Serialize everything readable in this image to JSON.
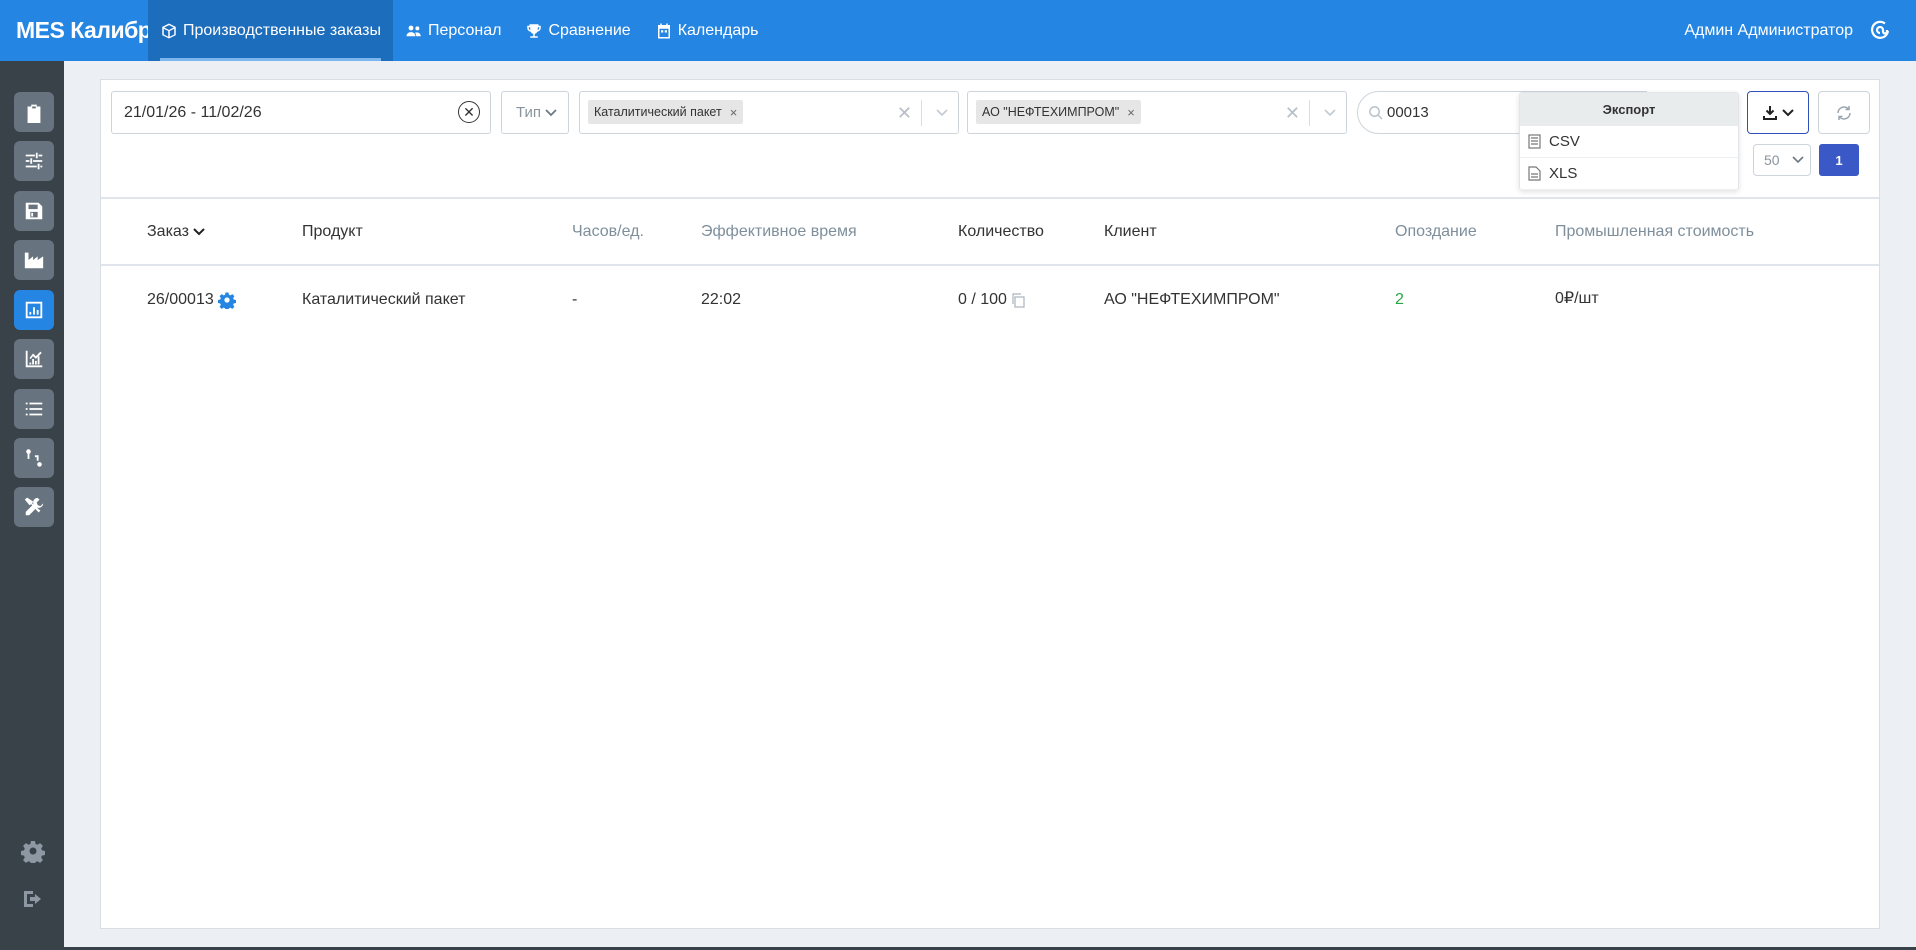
{
  "app": {
    "brand": "MES Калибр"
  },
  "nav": [
    {
      "label": "Производственные заказы",
      "icon": "box-icon",
      "active": true
    },
    {
      "label": "Персонал",
      "icon": "users-icon",
      "active": false
    },
    {
      "label": "Сравнение",
      "icon": "trophy-icon",
      "active": false
    },
    {
      "label": "Календарь",
      "icon": "calendar-icon",
      "active": false
    }
  ],
  "user": {
    "name": "Админ Администратор"
  },
  "filters": {
    "date_range": "21/01/26 - 11/02/26",
    "type_placeholder": "Тип",
    "product_chip": "Каталитический пакет",
    "client_chip": "АО \"НЕФТЕХИМПРОМ\"",
    "search_value": "00013"
  },
  "export_menu": {
    "title": "Экспорт",
    "items": [
      "CSV",
      "XLS"
    ]
  },
  "pagination": {
    "per_page": "50",
    "page": "1"
  },
  "table": {
    "headers": [
      "Заказ",
      "Продукт",
      "Часов/ед.",
      "Эффективное время",
      "Количество",
      "Клиент",
      "Опоздание",
      "Промышленная стоимость"
    ],
    "rows": [
      {
        "order": "26/00013",
        "product": "Каталитический пакет",
        "hours_per_unit": "-",
        "effective_time": "22:02",
        "quantity": "0 / 100",
        "client": "АО \"НЕФТЕХИМПРОМ\"",
        "delay": "2",
        "cost": "0₽/шт"
      }
    ]
  },
  "colors": {
    "primary": "#2585e2",
    "sidebar": "#3a4249",
    "page_button": "#3b59c6",
    "delay_green": "#28a745"
  }
}
